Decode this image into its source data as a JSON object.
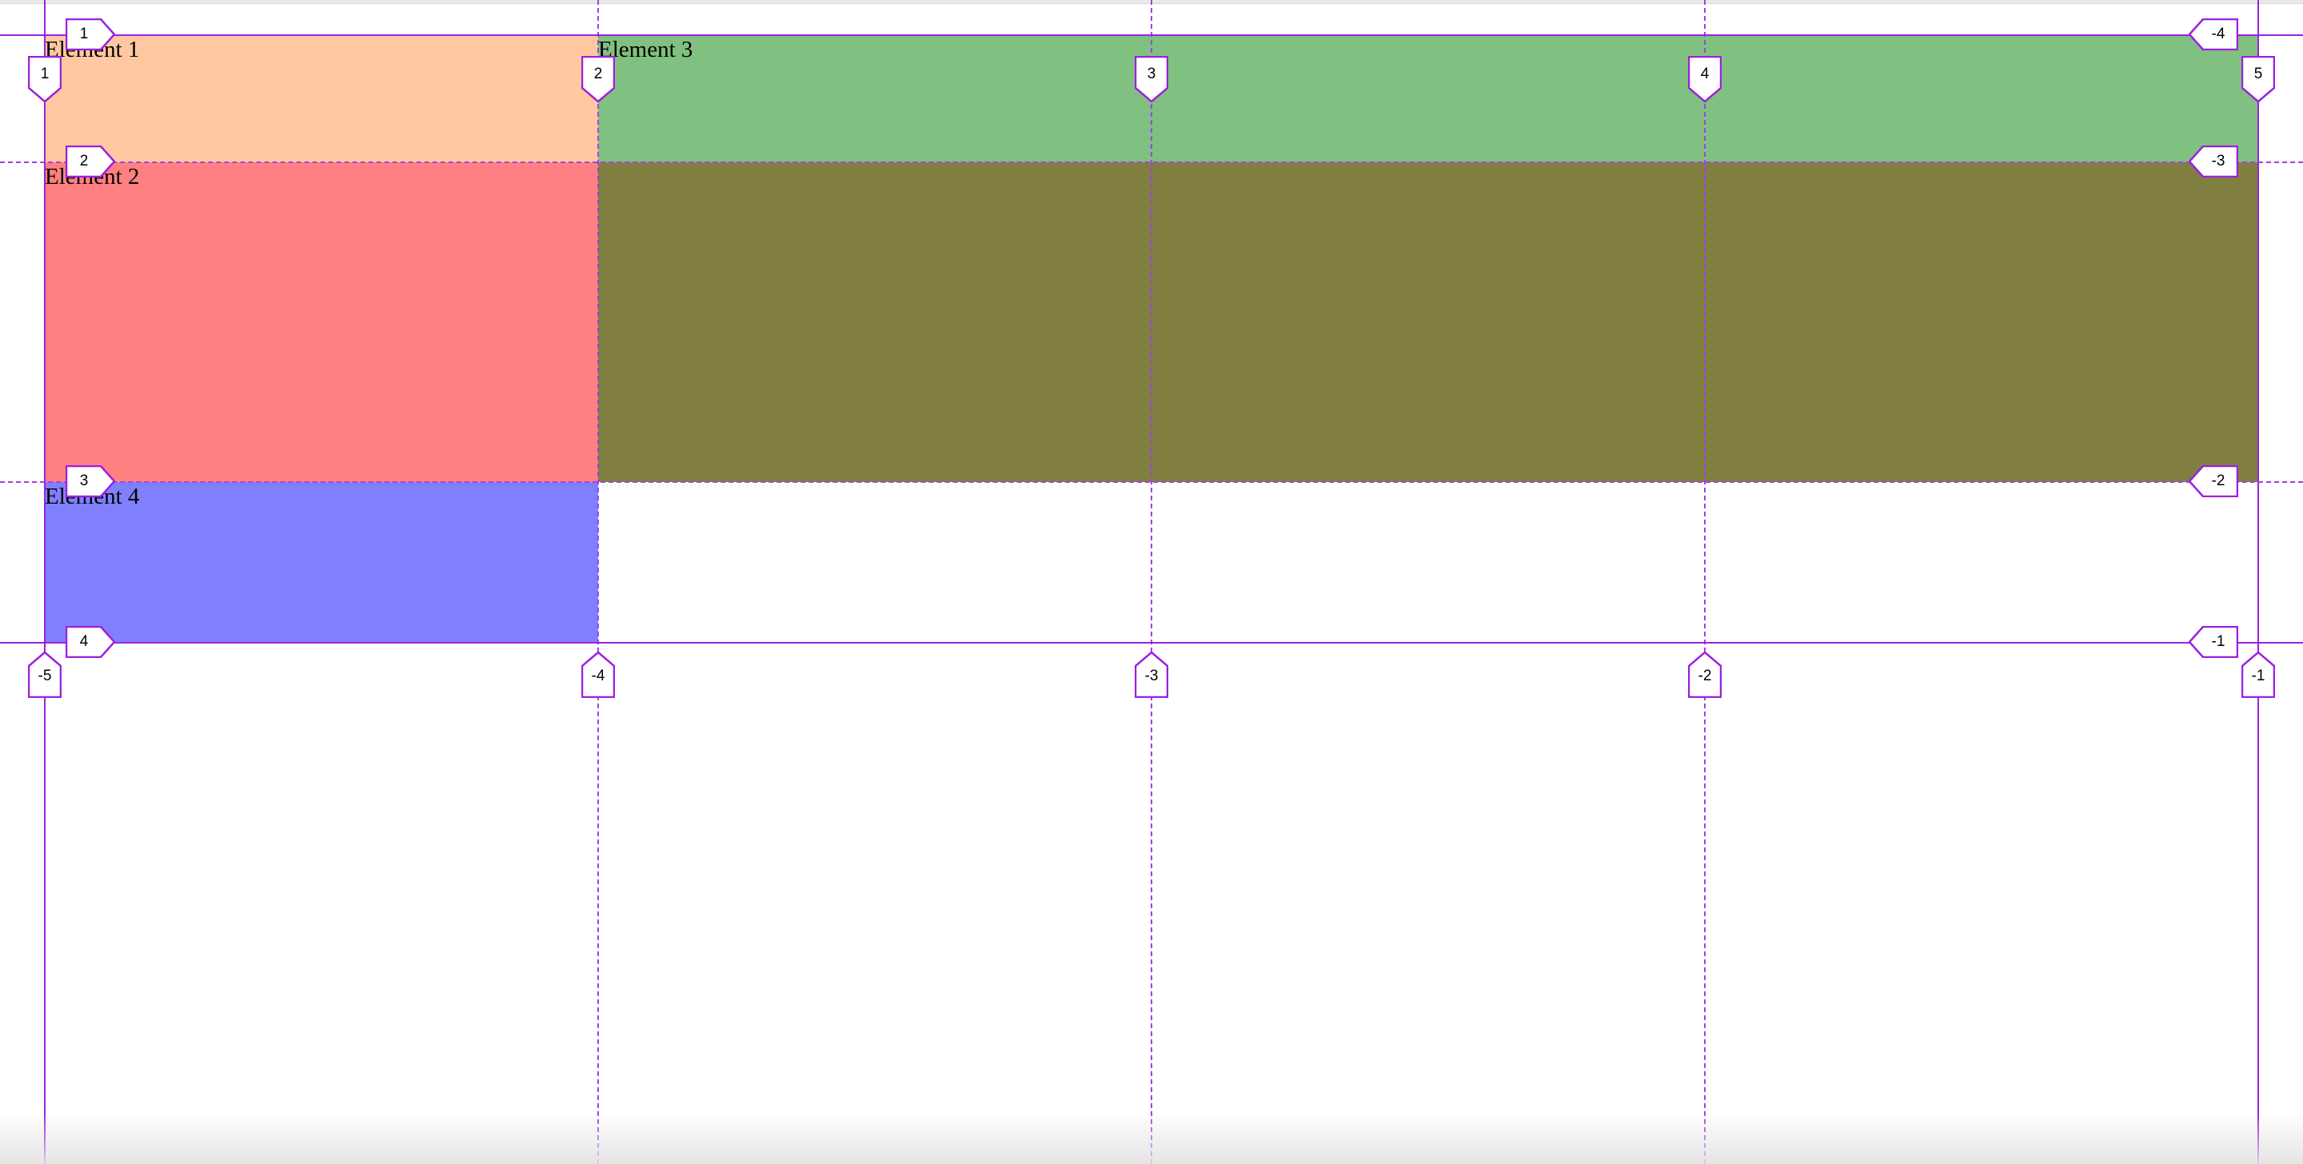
{
  "grid_items": {
    "element_1": "Element 1",
    "element_2": "Element 2",
    "element_3": "Element 3",
    "element_4": "Element 4"
  },
  "line_labels": {
    "col_top": [
      "1",
      "2",
      "3",
      "4",
      "5"
    ],
    "col_bottom": [
      "-5",
      "-4",
      "-3",
      "-2",
      "-1"
    ],
    "row_left": [
      "1",
      "2",
      "3",
      "4"
    ],
    "row_right": [
      "-4",
      "-3",
      "-2",
      "-1"
    ]
  },
  "colors": {
    "element_1": "#ffc8a0",
    "element_2": "#ff8080",
    "element_3": "#80c080",
    "overlap_2_3": "#807f40",
    "element_4": "#8080ff",
    "grid_overlay": "#9c20e0"
  }
}
